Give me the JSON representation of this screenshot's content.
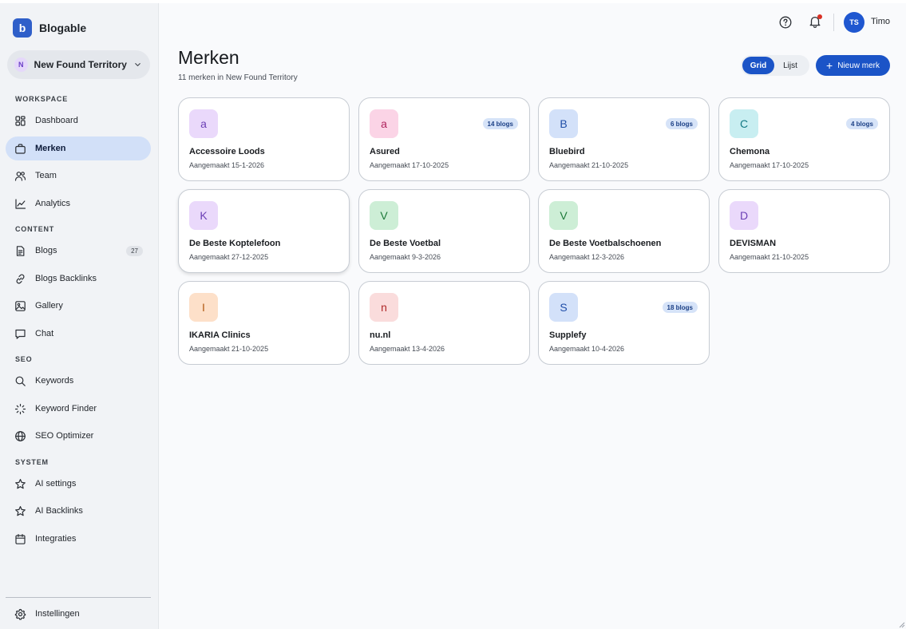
{
  "app": {
    "name": "Blogable",
    "logo_letter": "b",
    "accent": "#1b54c7"
  },
  "workspace": {
    "initial": "N",
    "name": "New Found Territory"
  },
  "nav": {
    "sections": [
      {
        "label": "WORKSPACE",
        "items": [
          {
            "label": "Dashboard",
            "icon": "dashboard-icon"
          },
          {
            "label": "Merken",
            "icon": "briefcase-icon",
            "active": true
          },
          {
            "label": "Team",
            "icon": "team-icon"
          },
          {
            "label": "Analytics",
            "icon": "analytics-icon"
          }
        ]
      },
      {
        "label": "CONTENT",
        "items": [
          {
            "label": "Blogs",
            "icon": "document-icon",
            "badge": "27"
          },
          {
            "label": "Blogs Backlinks",
            "icon": "link-icon"
          },
          {
            "label": "Gallery",
            "icon": "image-icon"
          },
          {
            "label": "Chat",
            "icon": "chat-icon"
          }
        ]
      },
      {
        "label": "SEO",
        "items": [
          {
            "label": "Keywords",
            "icon": "search-icon"
          },
          {
            "label": "Keyword Finder",
            "icon": "loader-icon"
          },
          {
            "label": "SEO Optimizer",
            "icon": "globe-icon"
          }
        ]
      },
      {
        "label": "SYSTEM",
        "items": [
          {
            "label": "AI settings",
            "icon": "star-icon"
          },
          {
            "label": "AI Backlinks",
            "icon": "star-icon"
          },
          {
            "label": "Integraties",
            "icon": "calendar-icon"
          }
        ]
      }
    ],
    "footer": {
      "label": "Instellingen",
      "icon": "gear-icon"
    }
  },
  "topbar": {
    "help_icon": "help-circle-icon",
    "notification_icon": "bell-icon",
    "notification_color": "#d93025",
    "user": {
      "initials": "TS",
      "name": "Timo"
    }
  },
  "page": {
    "title": "Merken",
    "subtitle": "11 merken in New Found Territory",
    "view_toggle": {
      "grid": "Grid",
      "list": "Lijst",
      "selected": "Grid"
    },
    "new_button": "Nieuw merk",
    "new_button_icon": "+"
  },
  "brands": [
    {
      "initial": "a",
      "name": "Accessoire Loods",
      "created": "Aangemaakt 15-1-2026",
      "badge": "",
      "bg": "#ead9fb",
      "fg": "#6b3fb5"
    },
    {
      "initial": "a",
      "name": "Asured",
      "created": "Aangemaakt 17-10-2025",
      "badge": "14 blogs",
      "bg": "#fbd4e6",
      "fg": "#b0245e"
    },
    {
      "initial": "B",
      "name": "Bluebird",
      "created": "Aangemaakt 21-10-2025",
      "badge": "6 blogs",
      "bg": "#d3e1f9",
      "fg": "#1f4ea8"
    },
    {
      "initial": "C",
      "name": "Chemona",
      "created": "Aangemaakt 17-10-2025",
      "badge": "4 blogs",
      "bg": "#c8eef1",
      "fg": "#137a85"
    },
    {
      "initial": "K",
      "name": "De Beste Koptelefoon",
      "created": "Aangemaakt 27-12-2025",
      "badge": "",
      "bg": "#ead9fb",
      "fg": "#6b3fb5"
    },
    {
      "initial": "V",
      "name": "De Beste Voetbal",
      "created": "Aangemaakt 9-3-2026",
      "badge": "",
      "bg": "#cdeed6",
      "fg": "#1e7a3a"
    },
    {
      "initial": "V",
      "name": "De Beste Voetbalschoenen",
      "created": "Aangemaakt 12-3-2026",
      "badge": "",
      "bg": "#cdeed6",
      "fg": "#1e7a3a"
    },
    {
      "initial": "D",
      "name": "DEVISMAN",
      "created": "Aangemaakt 21-10-2025",
      "badge": "",
      "bg": "#ead9fb",
      "fg": "#6b3fb5"
    },
    {
      "initial": "I",
      "name": "IKARIA Clinics",
      "created": "Aangemaakt 21-10-2025",
      "badge": "",
      "bg": "#fde0c9",
      "fg": "#b05a12"
    },
    {
      "initial": "n",
      "name": "nu.nl",
      "created": "Aangemaakt 13-4-2026",
      "badge": "",
      "bg": "#fadcdc",
      "fg": "#b02a2a"
    },
    {
      "initial": "S",
      "name": "Supplefy",
      "created": "Aangemaakt 10-4-2026",
      "badge": "18 blogs",
      "bg": "#d3e1f9",
      "fg": "#1f4ea8"
    }
  ]
}
